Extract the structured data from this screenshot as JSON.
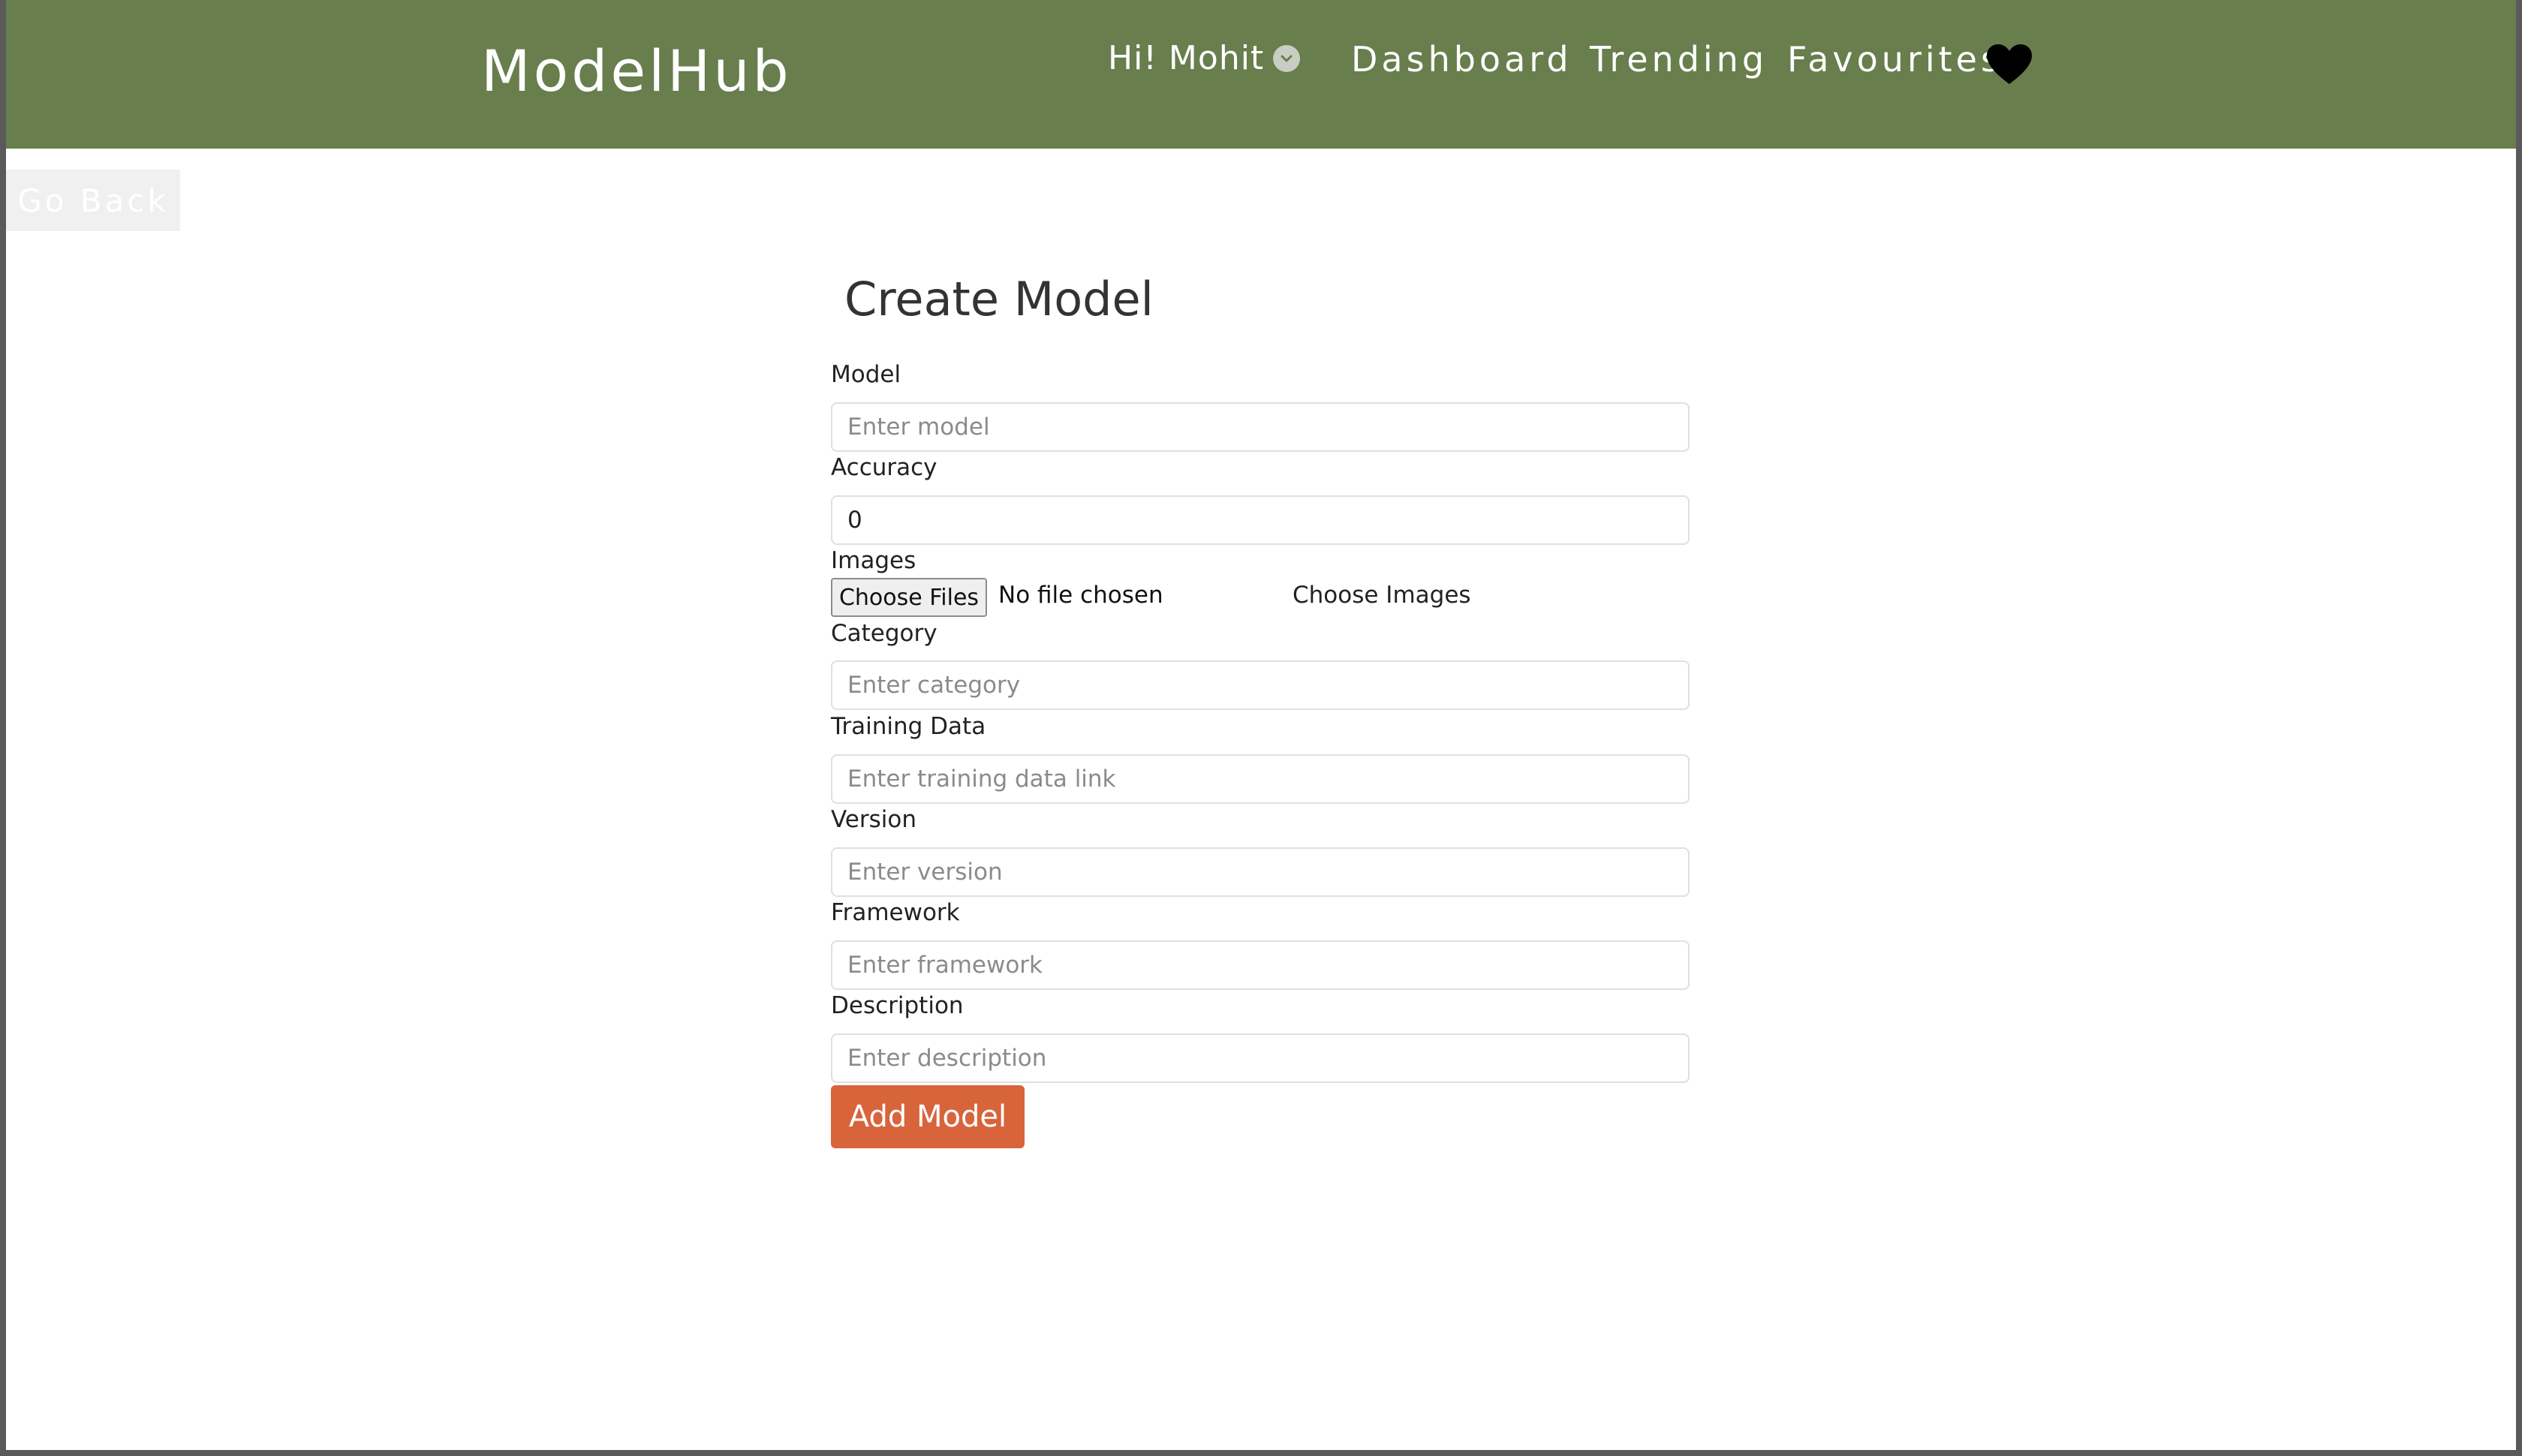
{
  "header": {
    "brand": "ModelHub",
    "user_greeting": "Hi! Mohit",
    "nav": {
      "dashboard": "Dashboard",
      "trending": "Trending",
      "favourites": "Favourites"
    },
    "icons": {
      "user_menu": "chevron-down-icon",
      "favourites": "heart-icon"
    },
    "background_color": "#687e4d"
  },
  "go_back_label": "Go Back",
  "form": {
    "title": "Create Model",
    "fields": {
      "model": {
        "label": "Model",
        "placeholder": "Enter model",
        "value": ""
      },
      "accuracy": {
        "label": "Accuracy",
        "placeholder": "",
        "value": "0"
      },
      "images": {
        "label": "Images",
        "button": "Choose Files",
        "status": "No file chosen",
        "hint": "Choose Images"
      },
      "category": {
        "label": "Category",
        "placeholder": "Enter category",
        "value": ""
      },
      "training_data": {
        "label": "Training Data",
        "placeholder": "Enter training data link",
        "value": ""
      },
      "version": {
        "label": "Version",
        "placeholder": "Enter version",
        "value": ""
      },
      "framework": {
        "label": "Framework",
        "placeholder": "Enter framework",
        "value": ""
      },
      "description": {
        "label": "Description",
        "placeholder": "Enter description",
        "value": ""
      }
    },
    "submit_label": "Add Model",
    "submit_color": "#d8643c"
  }
}
